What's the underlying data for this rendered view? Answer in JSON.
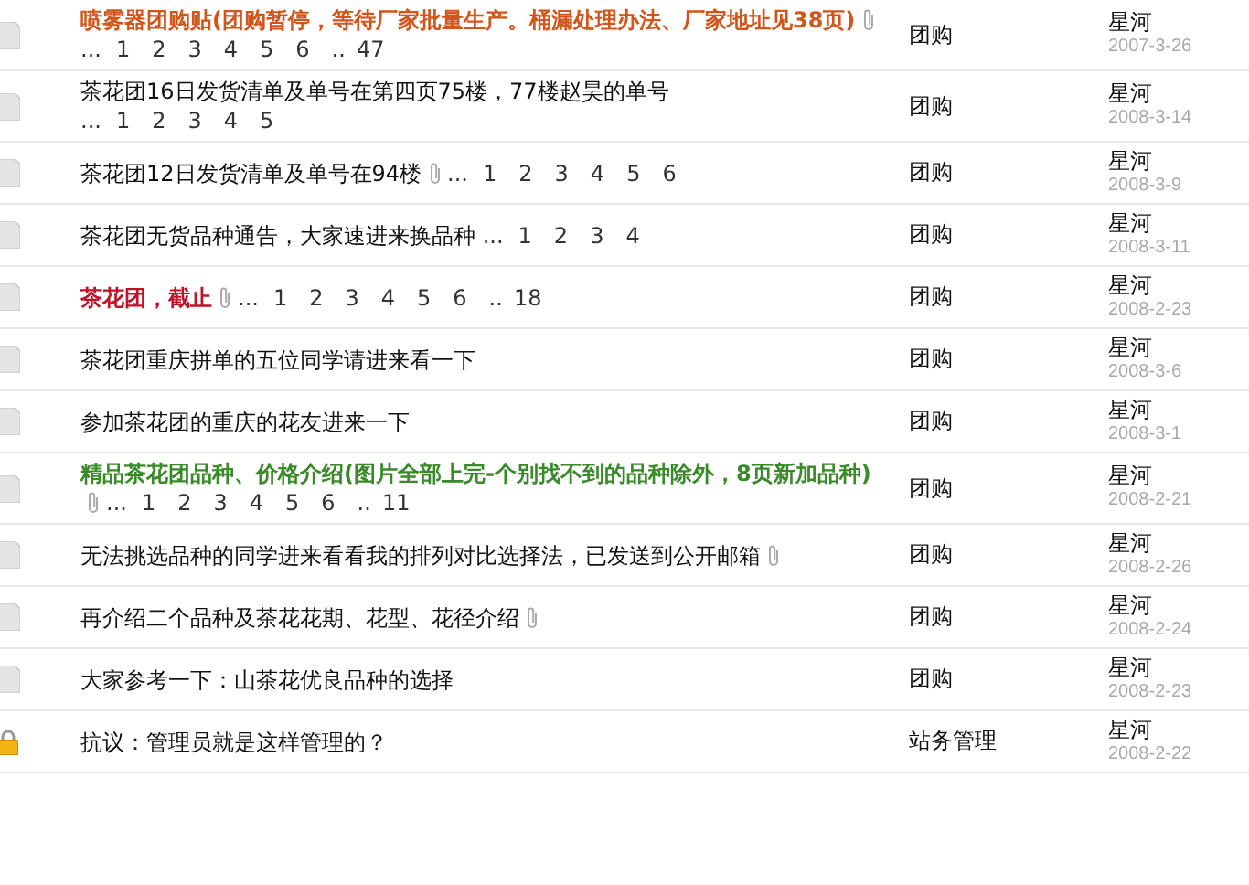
{
  "topics": [
    {
      "kind": "topic",
      "title": "喷雾器团购贴(团购暂停，等待厂家批量生产。桶漏处理办法、厂家地址见38页)",
      "bold": true,
      "color": "#d2561c",
      "attachment": true,
      "pager": {
        "lead": "...",
        "pages": [
          "1",
          "2",
          "3",
          "4",
          "5",
          "6"
        ],
        "gap": "..",
        "last": "47"
      },
      "forum": "团购",
      "author": "星河",
      "date": "2007-3-26"
    },
    {
      "kind": "topic",
      "title": "茶花团16日发货清单及单号在第四页75楼，77楼赵昊的单号",
      "bold": false,
      "attachment": false,
      "pager": {
        "lead": "...",
        "pages": [
          "1",
          "2",
          "3",
          "4",
          "5"
        ]
      },
      "forum": "团购",
      "author": "星河",
      "date": "2008-3-14"
    },
    {
      "kind": "topic",
      "title": "茶花团12日发货清单及单号在94楼",
      "bold": false,
      "attachment": true,
      "pager": {
        "lead": "...",
        "pages": [
          "1",
          "2",
          "3",
          "4",
          "5",
          "6"
        ]
      },
      "forum": "团购",
      "author": "星河",
      "date": "2008-3-9"
    },
    {
      "kind": "topic",
      "title": "茶花团无货品种通告，大家速进来换品种",
      "bold": false,
      "attachment": false,
      "pager": {
        "lead": "...",
        "pages": [
          "1",
          "2",
          "3",
          "4"
        ]
      },
      "forum": "团购",
      "author": "星河",
      "date": "2008-3-11"
    },
    {
      "kind": "topic",
      "title": "茶花团，截止",
      "bold": true,
      "color": "#c0142a",
      "attachment": true,
      "pager": {
        "lead": "...",
        "pages": [
          "1",
          "2",
          "3",
          "4",
          "5",
          "6"
        ],
        "gap": "..",
        "last": "18"
      },
      "forum": "团购",
      "author": "星河",
      "date": "2008-2-23"
    },
    {
      "kind": "topic",
      "title": "茶花团重庆拼单的五位同学请进来看一下",
      "bold": false,
      "attachment": false,
      "forum": "团购",
      "author": "星河",
      "date": "2008-3-6"
    },
    {
      "kind": "topic",
      "title": "参加茶花团的重庆的花友进来一下",
      "bold": false,
      "attachment": false,
      "forum": "团购",
      "author": "星河",
      "date": "2008-3-1"
    },
    {
      "kind": "topic",
      "title": "精品茶花团品种、价格介绍(图片全部上完-个别找不到的品种除外，8页新加品种)",
      "bold": true,
      "color": "#3a8a2a",
      "attachment": true,
      "pager": {
        "lead": "...",
        "pages": [
          "1",
          "2",
          "3",
          "4",
          "5",
          "6"
        ],
        "gap": "..",
        "last": "11"
      },
      "forum": "团购",
      "author": "星河",
      "date": "2008-2-21"
    },
    {
      "kind": "topic",
      "title": "无法挑选品种的同学进来看看我的排列对比选择法，已发送到公开邮箱",
      "bold": false,
      "attachment": true,
      "forum": "团购",
      "author": "星河",
      "date": "2008-2-26"
    },
    {
      "kind": "topic",
      "title": "再介绍二个品种及茶花花期、花型、花径介绍",
      "bold": false,
      "attachment": true,
      "forum": "团购",
      "author": "星河",
      "date": "2008-2-24"
    },
    {
      "kind": "topic",
      "title": "大家参考一下：山茶花优良品种的选择",
      "bold": false,
      "attachment": false,
      "forum": "团购",
      "author": "星河",
      "date": "2008-2-23"
    },
    {
      "kind": "locked",
      "title": "抗议：管理员就是这样管理的？",
      "bold": false,
      "attachment": false,
      "forum": "站务管理",
      "author": "星河",
      "date": "2008-2-22"
    }
  ]
}
